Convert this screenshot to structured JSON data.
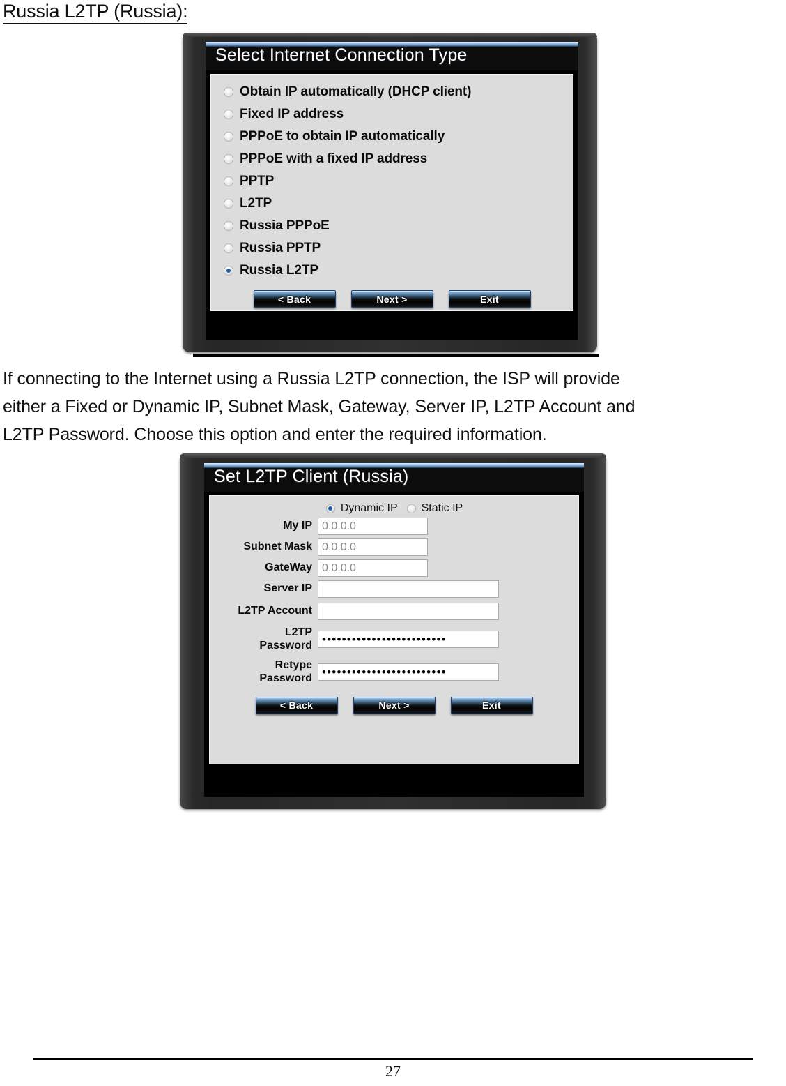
{
  "heading": "Russia L2TP (Russia):",
  "dialog1": {
    "title": "Select Internet Connection Type",
    "options": [
      {
        "label": "Obtain IP automatically (DHCP client)",
        "selected": false
      },
      {
        "label": "Fixed IP address",
        "selected": false
      },
      {
        "label": "PPPoE to obtain IP automatically",
        "selected": false
      },
      {
        "label": "PPPoE with a fixed IP address",
        "selected": false
      },
      {
        "label": "PPTP",
        "selected": false
      },
      {
        "label": "L2TP",
        "selected": false
      },
      {
        "label": "Russia PPPoE",
        "selected": false
      },
      {
        "label": "Russia PPTP",
        "selected": false
      },
      {
        "label": "Russia L2TP",
        "selected": true
      }
    ],
    "buttons": {
      "back": "< Back",
      "next": "Next >",
      "exit": "Exit"
    }
  },
  "paragraph": {
    "line1": "If connecting to the Internet using a Russia L2TP connection, the ISP will provide",
    "line2": "either a Fixed or Dynamic IP, Subnet Mask, Gateway, Server IP, L2TP Account and",
    "line3": "L2TP Password. Choose this option and enter the required information."
  },
  "dialog2": {
    "title": "Set L2TP Client (Russia)",
    "ip_mode": {
      "dynamic_label": "Dynamic IP",
      "static_label": "Static IP",
      "selected": "Dynamic IP"
    },
    "fields": [
      {
        "label": "My IP",
        "value": "0.0.0.0",
        "type": "text",
        "width": "short"
      },
      {
        "label": "Subnet Mask",
        "value": "0.0.0.0",
        "type": "text",
        "width": "short"
      },
      {
        "label": "GateWay",
        "value": "0.0.0.0",
        "type": "text",
        "width": "short"
      },
      {
        "label": "Server IP",
        "value": "",
        "type": "text",
        "width": "long"
      },
      {
        "label": "L2TP Account",
        "value": "",
        "type": "text",
        "width": "long"
      },
      {
        "label": "L2TP\nPassword",
        "value": "•••••••••••••••••••••••••",
        "type": "password",
        "width": "long"
      },
      {
        "label": "Retype\nPassword",
        "value": "•••••••••••••••••••••••••",
        "type": "password",
        "width": "long"
      }
    ],
    "buttons": {
      "back": "< Back",
      "next": "Next >",
      "exit": "Exit"
    }
  },
  "footer": {
    "page_number": "27"
  },
  "colors": {
    "accent_blue": "#1b5fa8",
    "dialog_body": "#dcdcdc",
    "title_bar": "#0c0c0c",
    "placeholder_text": "#8a8a8a"
  }
}
